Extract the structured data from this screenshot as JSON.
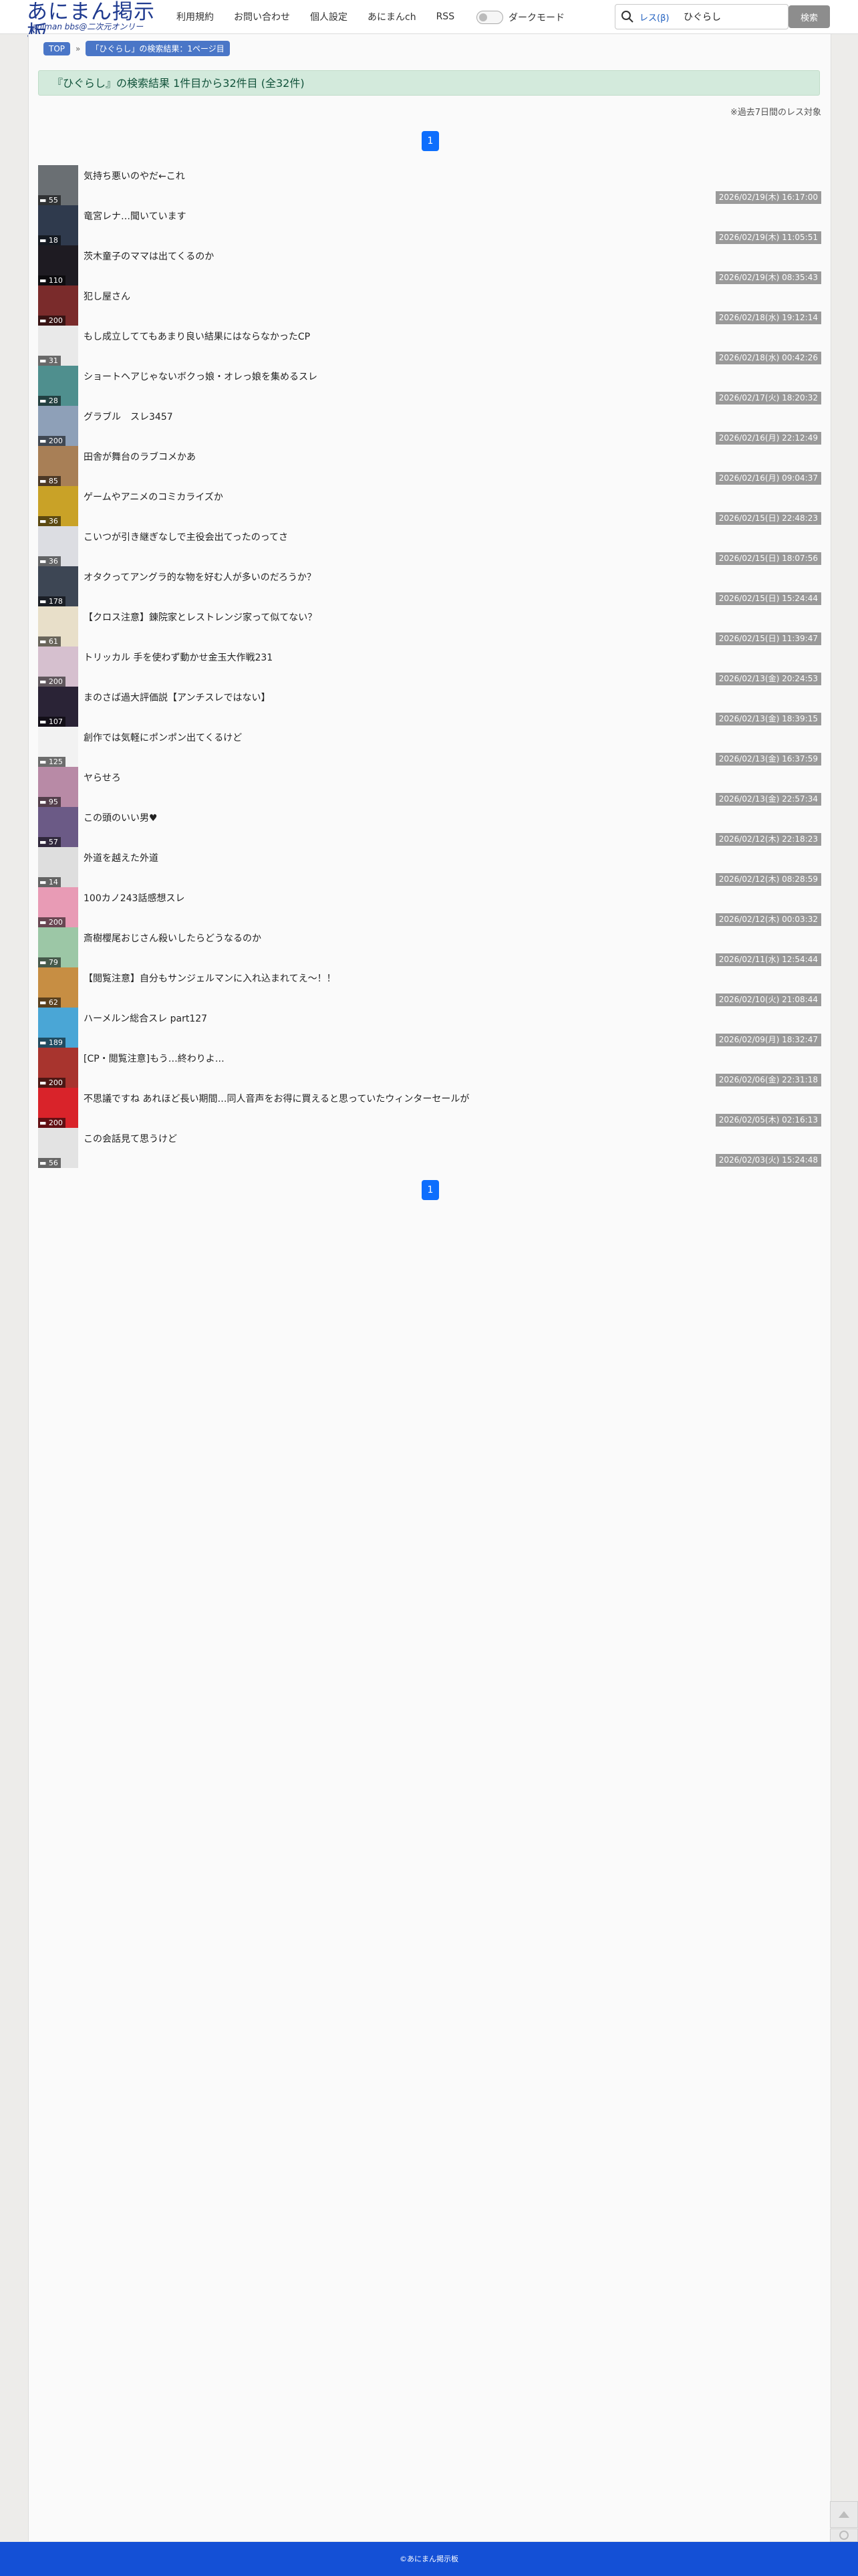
{
  "header": {
    "logo_main": "あにまん掲示板",
    "logo_sub": "animan bbs@二次元オンリー",
    "nav": [
      "利用規約",
      "お問い合わせ",
      "個人設定",
      "あにまんch",
      "RSS"
    ],
    "dark_mode_label": "ダークモード",
    "dark_mode_on": false,
    "search_scope": "レス(β)",
    "search_value": "ひぐらし",
    "search_button": "検索"
  },
  "breadcrumb": [
    "TOP",
    "「ひぐらし」の検索結果：1ページ目"
  ],
  "result_summary": "『ひぐらし』の検索結果 1件目から32件目 (全32件)",
  "note": "※過去7日間のレス対象",
  "pagination": {
    "current": "1"
  },
  "threads": [
    {
      "title": "気持ち悪いのやだ←これ",
      "count": "55",
      "time": "2026/02/19(木) 16:17:00",
      "thumb": "#6a6f73"
    },
    {
      "title": "竜宮レナ…聞いています",
      "count": "18",
      "time": "2026/02/19(木) 11:05:51",
      "thumb": "#2f3a4d"
    },
    {
      "title": "茨木童子のママは出てくるのか",
      "count": "110",
      "time": "2026/02/19(木) 08:35:43",
      "thumb": "#1e1b22"
    },
    {
      "title": "犯し屋さん",
      "count": "200",
      "time": "2026/02/18(水) 19:12:14",
      "thumb": "#7a2b2b"
    },
    {
      "title": "もし成立しててもあまり良い結果にはならなかったCP",
      "count": "31",
      "time": "2026/02/18(水) 00:42:26",
      "thumb": "#e9e9e9"
    },
    {
      "title": "ショートヘアじゃないボクっ娘・オレっ娘を集めるスレ",
      "count": "28",
      "time": "2026/02/17(火) 18:20:32",
      "thumb": "#4f8f8e"
    },
    {
      "title": "グラブル　スレ3457",
      "count": "200",
      "time": "2026/02/16(月) 22:12:49",
      "thumb": "#8ea0b8"
    },
    {
      "title": "田舎が舞台のラブコメかあ",
      "count": "85",
      "time": "2026/02/16(月) 09:04:37",
      "thumb": "#a87f56"
    },
    {
      "title": "ゲームやアニメのコミカライズか",
      "count": "36",
      "time": "2026/02/15(日) 22:48:23",
      "thumb": "#c9a227"
    },
    {
      "title": "こいつが引き継ぎなしで主役会出てったのってさ",
      "count": "36",
      "time": "2026/02/15(日) 18:07:56",
      "thumb": "#dcdde2"
    },
    {
      "title": "オタクってアングラ的な物を好む人が多いのだろうか？",
      "count": "178",
      "time": "2026/02/15(日) 15:24:44",
      "thumb": "#3d4654"
    },
    {
      "title": "【クロス注意】錬院家とレストレンジ家って似てない？",
      "count": "61",
      "time": "2026/02/15(日) 11:39:47",
      "thumb": "#e8dfc9"
    },
    {
      "title": "トリッカル 手を使わず動かせ金玉大作戦231",
      "count": "200",
      "time": "2026/02/13(金) 20:24:53",
      "thumb": "#d6c0cf"
    },
    {
      "title": "まのさば過大評価説【アンチスレではない】",
      "count": "107",
      "time": "2026/02/13(金) 18:39:15",
      "thumb": "#2a2336"
    },
    {
      "title": "創作では気軽にポンポン出てくるけど",
      "count": "125",
      "time": "2026/02/13(金) 16:37:59",
      "thumb": "#f2f2f2"
    },
    {
      "title": "ヤらせろ",
      "count": "95",
      "time": "2026/02/13(金) 22:57:34",
      "thumb": "#b88aa6"
    },
    {
      "title": "この頭のいい男♥",
      "count": "57",
      "time": "2026/02/12(木) 22:18:23",
      "thumb": "#6b5a86"
    },
    {
      "title": "外道を越えた外道",
      "count": "14",
      "time": "2026/02/12(木) 08:28:59",
      "thumb": "#dedede"
    },
    {
      "title": "100カノ243話感想スレ",
      "count": "200",
      "time": "2026/02/12(木) 00:03:32",
      "thumb": "#e89bb5"
    },
    {
      "title": "斎樹櫻尾おじさん殺いしたらどうなるのか",
      "count": "79",
      "time": "2026/02/11(水) 12:54:44",
      "thumb": "#9cc7a6"
    },
    {
      "title": "【閲覧注意】自分もサンジェルマンに入れ込まれてえ〜！！",
      "count": "62",
      "time": "2026/02/10(火) 21:08:44",
      "thumb": "#c78e43"
    },
    {
      "title": "ハーメルン総合スレ part127",
      "count": "189",
      "time": "2026/02/09(月) 18:32:47",
      "thumb": "#4aa6d6"
    },
    {
      "title": "[CP・閲覧注意]もう…終わりよ…",
      "count": "200",
      "time": "2026/02/06(金) 22:31:18",
      "thumb": "#a8342e"
    },
    {
      "title": "不思議ですね あれほど長い期間…同人音声をお得に買えると思っていたウィンターセールが",
      "count": "200",
      "time": "2026/02/05(木) 02:16:13",
      "thumb": "#d9232a"
    },
    {
      "title": "この会話見て思うけど",
      "count": "56",
      "time": "2026/02/03(火) 15:24:48",
      "thumb": "#e3e3e3"
    }
  ],
  "footer": "©あにまん掲示板"
}
